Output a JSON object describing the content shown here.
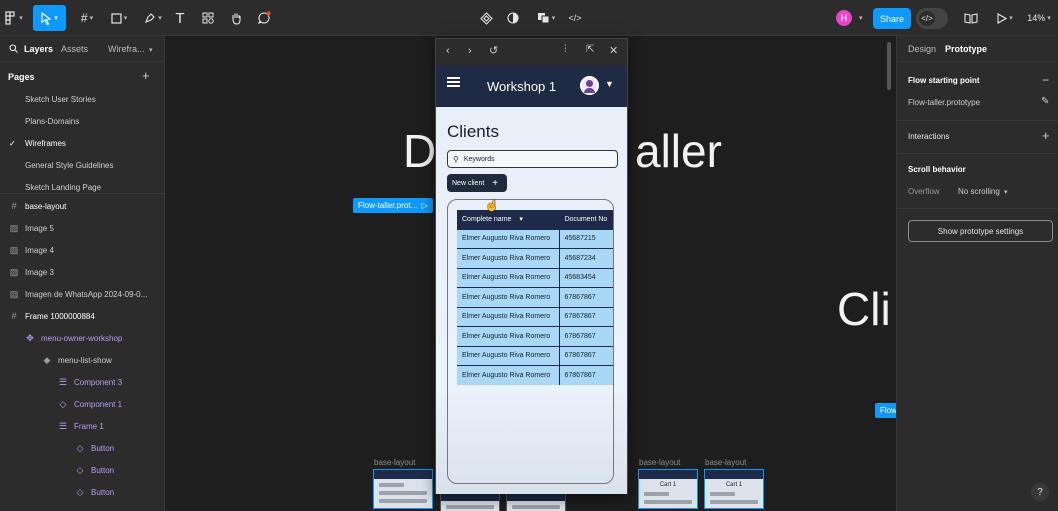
{
  "toolbar": {
    "move_icon": "cursor-arrow-icon",
    "zoom": "14%",
    "share_label": "Share",
    "avatar_initial": "H",
    "devmode_glyph": "</>"
  },
  "left_panel": {
    "tabs": [
      "Layers",
      "Assets"
    ],
    "page_switcher": "Wirefra...",
    "pages_title": "Pages",
    "pages": [
      "Sketch User Stories",
      "Plans-Domains",
      "Wireframes",
      "General Style Guidelines",
      "Sketch Landing Page"
    ],
    "current_page": "Wireframes",
    "layers": [
      {
        "name": "base-layout",
        "icon": "#"
      },
      {
        "name": "Image 5",
        "icon": "▨"
      },
      {
        "name": "Image 4",
        "icon": "▨"
      },
      {
        "name": "Image 3",
        "icon": "▨"
      },
      {
        "name": "Imagen de WhatsApp 2024-09-0...",
        "icon": "▨"
      },
      {
        "name": "Frame 1000000884",
        "icon": "#"
      },
      {
        "name": "menu-owner-workshop",
        "icon": "✥"
      },
      {
        "name": "menu-list-show",
        "icon": "◆"
      },
      {
        "name": "Component 3",
        "icon": "☰"
      },
      {
        "name": "Component 1",
        "icon": "◇"
      },
      {
        "name": "Frame 1",
        "icon": "☰"
      },
      {
        "name": "Button",
        "icon": "◇"
      },
      {
        "name": "Button",
        "icon": "◇"
      },
      {
        "name": "Button",
        "icon": "◇"
      }
    ]
  },
  "canvas": {
    "big_left": "D",
    "big_right": "aller",
    "big_cli": "Cli",
    "flow_tag": "Flow-taller.prot...",
    "flow_tag_right": "Flow",
    "frame_labels": [
      "base-layout",
      "base-layout",
      "base-layout"
    ],
    "thumb_cart_label": "Cart 1"
  },
  "preview": {
    "app_title": "Workshop 1",
    "page_heading": "Clients",
    "search_placeholder": "Keywords",
    "new_button": "New client",
    "table": {
      "headers": [
        "Complete name",
        "Document No"
      ],
      "rows": [
        [
          "Elmer Augusto Riva Romero",
          "45687215"
        ],
        [
          "Elmer Augusto Riva Romero",
          "45687234"
        ],
        [
          "Elmer Augusto Riva Romero",
          "45683454"
        ],
        [
          "Elmer Augusto Riva Romero",
          "67867867"
        ],
        [
          "Elmer Augusto Riva Romero",
          "67867867"
        ],
        [
          "Elmer Augusto Riva Romero",
          "67867867"
        ],
        [
          "Elmer Augusto Riva Romero",
          "67867867"
        ],
        [
          "Elmer Augusto Riva Romero",
          "67867867"
        ]
      ]
    }
  },
  "right_panel": {
    "tabs": [
      "Design",
      "Prototype"
    ],
    "flow_heading": "Flow starting point",
    "flow_name": "Flow-taller.prototype",
    "interactions_heading": "Interactions",
    "scroll_heading": "Scroll behavior",
    "overflow_label": "Overflow",
    "overflow_value": "No scrolling",
    "settings_button": "Show prototype settings"
  },
  "colors": {
    "accent": "#0d99ff",
    "app_bar": "#1f2a44",
    "table_cell": "#a8d8f5"
  }
}
